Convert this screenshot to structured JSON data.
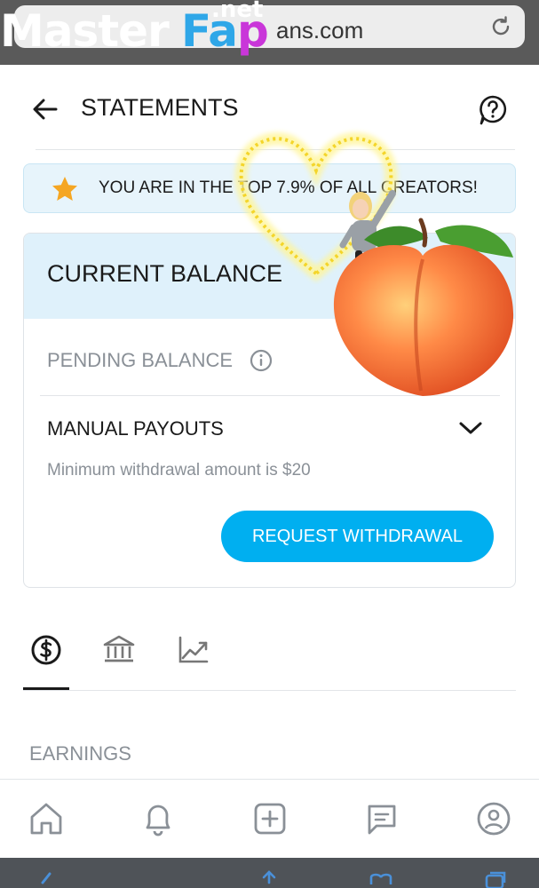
{
  "browser": {
    "url_text": "ans.com",
    "watermark_main": "Master",
    "watermark_accent_f": "F",
    "watermark_accent_a": "a",
    "watermark_accent_p": "p",
    "watermark_net": ".net"
  },
  "header": {
    "title": "STATEMENTS",
    "back_icon": "arrow-left-icon",
    "help_icon": "help-circle-icon"
  },
  "banner": {
    "text": "YOU ARE IN THE TOP 7.9% OF ALL CREATORS!",
    "icon": "star-icon",
    "color_star": "#f5a623"
  },
  "balance": {
    "title": "CURRENT BALANCE",
    "pending_label": "PENDING BALANCE",
    "payouts_label": "MANUAL PAYOUTS",
    "min_text": "Minimum withdrawal amount is $20",
    "withdraw_button": "REQUEST WITHDRAWAL"
  },
  "tabs": [
    {
      "icon": "dollar-circle-icon",
      "active": true
    },
    {
      "icon": "bank-icon",
      "active": false
    },
    {
      "icon": "chart-line-icon",
      "active": false
    }
  ],
  "section": {
    "earnings_label": "EARNINGS"
  },
  "bottom_nav": [
    {
      "icon": "home-icon"
    },
    {
      "icon": "bell-icon"
    },
    {
      "icon": "plus-square-icon"
    },
    {
      "icon": "message-icon"
    },
    {
      "icon": "profile-icon"
    }
  ],
  "colors": {
    "accent": "#00aff0",
    "banner_bg": "#e7f4fb",
    "balance_head_bg": "#dff1fb",
    "muted_text": "#8a9097"
  }
}
